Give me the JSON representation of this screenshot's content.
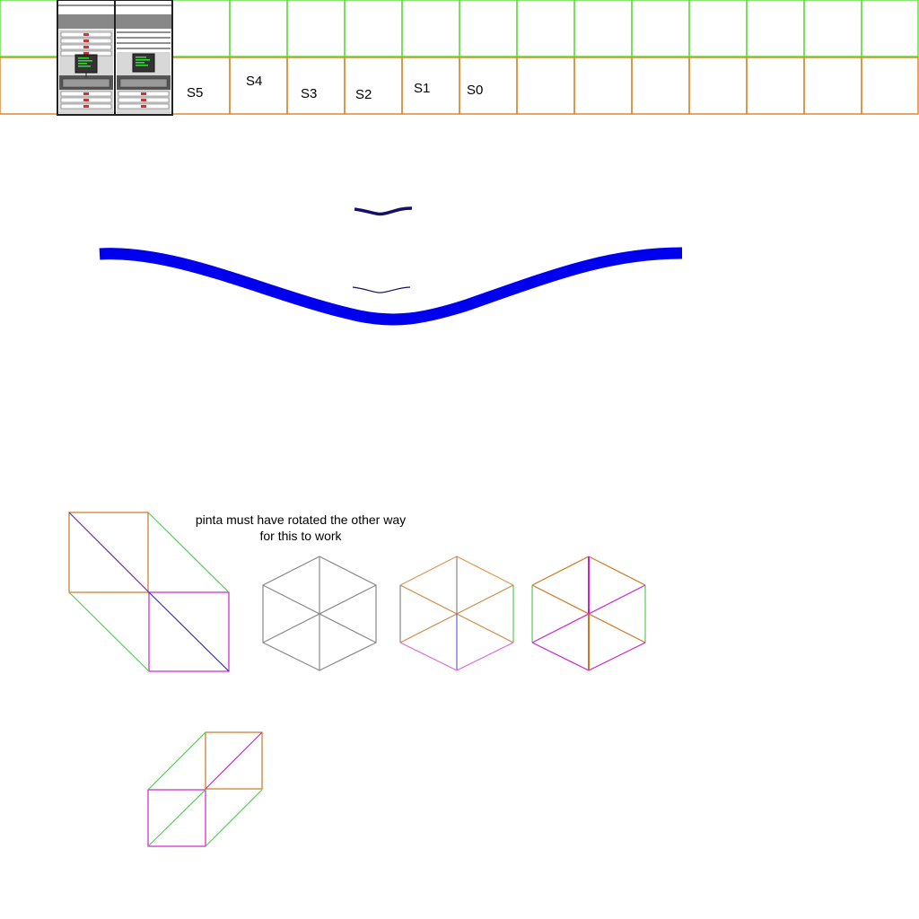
{
  "slots": [
    "S5",
    "S4",
    "S3",
    "S2",
    "S1",
    "S0"
  ],
  "note": {
    "line1": "pinta must have rotated the other way",
    "line2": "for this to work"
  },
  "colors": {
    "grid_top": "#66dd44",
    "grid_bottom": "#dd8833",
    "wave_big": "#0000ee",
    "wave_small": "#111166",
    "hex_gray": "#888888",
    "green": "#55cc55",
    "orange": "#cc7722",
    "magenta": "#cc22cc",
    "blue": "#3333aa",
    "purple": "#663399",
    "rack_frame": "#222222",
    "rack_screen": "#33dd33"
  }
}
